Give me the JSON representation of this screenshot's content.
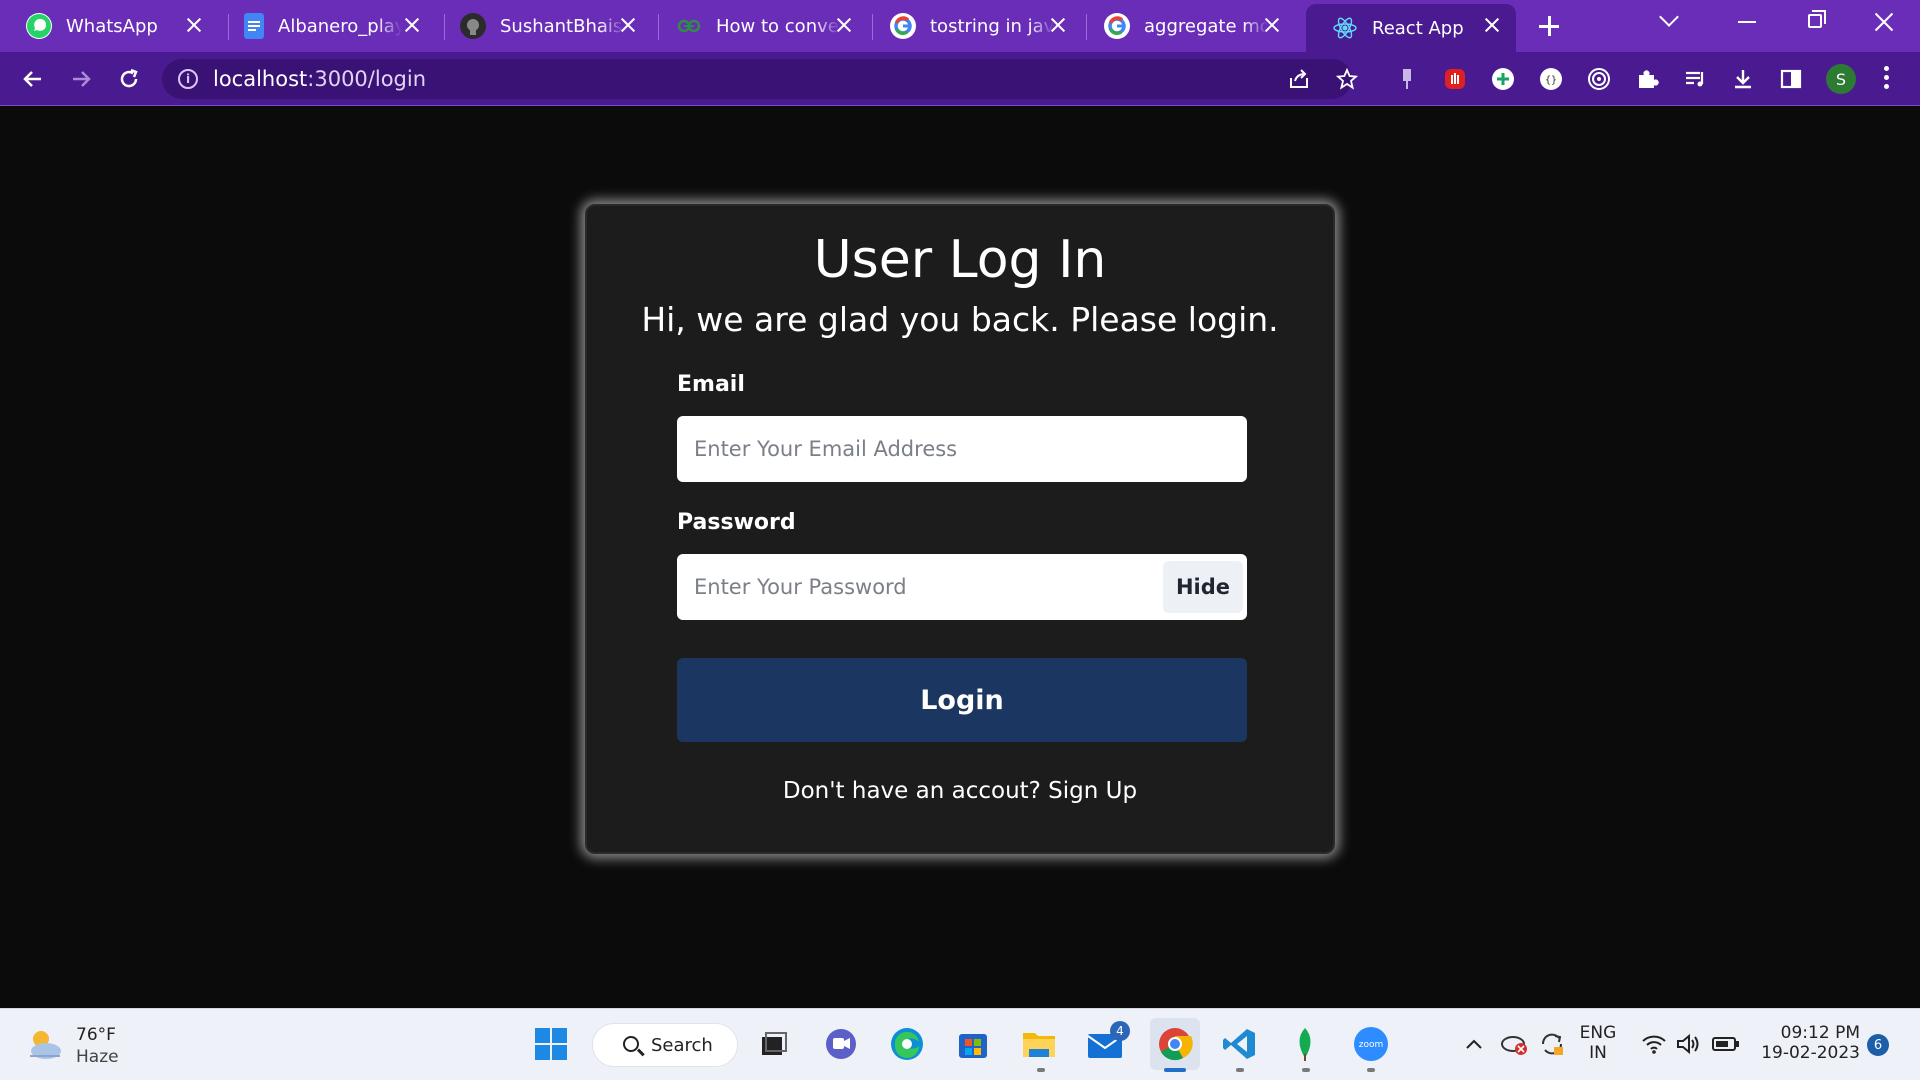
{
  "browser": {
    "tabs": [
      {
        "title": "WhatsApp",
        "icon": "whatsapp-icon"
      },
      {
        "title": "Albanero_playbook",
        "icon": "google-docs-icon"
      },
      {
        "title": "SushantBhaiswar",
        "icon": "github-icon"
      },
      {
        "title": "How to convert",
        "icon": "geeksforgeeks-icon"
      },
      {
        "title": "tostring in java",
        "icon": "google-icon"
      },
      {
        "title": "aggregate mongo",
        "icon": "google-icon"
      },
      {
        "title": "React App",
        "icon": "react-icon",
        "active": true
      }
    ],
    "url": {
      "host": "localhost",
      "path": ":3000/login"
    },
    "profile_initial": "S"
  },
  "login": {
    "title": "User Log In",
    "subtitle": "Hi, we are glad you back. Please login.",
    "email_label": "Email",
    "email_placeholder": "Enter Your Email Address",
    "password_label": "Password",
    "password_placeholder": "Enter Your Password",
    "hide_label": "Hide",
    "login_button": "Login",
    "signup_text": "Don't have an accout? Sign Up"
  },
  "taskbar": {
    "weather_temp": "76°F",
    "weather_condition": "Haze",
    "search_label": "Search",
    "mail_badge": "4",
    "language": "ENG",
    "region": "IN",
    "time": "09:12 PM",
    "date": "19-02-2023",
    "notification_count": "6"
  },
  "colors": {
    "tab_strip": "#6a2db8",
    "toolbar": "#4a1a91",
    "card_bg": "#1c1c1c",
    "login_button": "#1b3660"
  }
}
